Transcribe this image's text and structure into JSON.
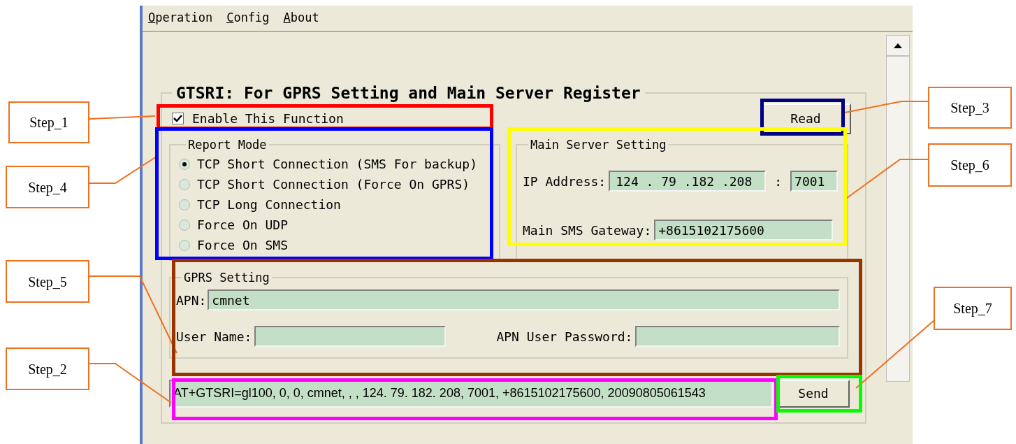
{
  "menu": [
    {
      "label": "Operation"
    },
    {
      "label": "Config"
    },
    {
      "label": "About"
    }
  ],
  "group_title": "GTSRI: For GPRS Setting and Main Server Register",
  "enable": {
    "label": "Enable This Function",
    "checked": true
  },
  "read_button": "Read",
  "report_mode": {
    "title": "Report Mode",
    "options": [
      {
        "label": "TCP Short Connection (SMS For backup)",
        "selected": true
      },
      {
        "label": "TCP Short Connection (Force On GPRS)",
        "selected": false
      },
      {
        "label": "TCP Long Connection",
        "selected": false
      },
      {
        "label": "Force On UDP",
        "selected": false
      },
      {
        "label": "Force On SMS",
        "selected": false
      }
    ]
  },
  "main_server": {
    "title": "Main Server Setting",
    "ip_label": "IP Address:",
    "ip_value": "124 . 79 .182 .208",
    "port_separator": ":",
    "port_value": "7001",
    "sms_label": "Main SMS Gateway:",
    "sms_value": "+8615102175600"
  },
  "gprs": {
    "title": "GPRS Setting",
    "apn_label": "APN:",
    "apn_value": "cmnet",
    "user_label": "User Name:",
    "password_label": "APN User Password:"
  },
  "command": "AT+GTSRI=gl100, 0, 0, cmnet, , , 124. 79. 182. 208, 7001, +8615102175600, 20090805061543",
  "send_button": "Send",
  "annotations": [
    {
      "label": "Step_1",
      "color": "#ff0000"
    },
    {
      "label": "Step_2",
      "color": "#ff00ff"
    },
    {
      "label": "Step_3",
      "color": "#000080"
    },
    {
      "label": "Step_4",
      "color": "#0000ff"
    },
    {
      "label": "Step_5",
      "color": "#993300"
    },
    {
      "label": "Step_6",
      "color": "#ffff00"
    },
    {
      "label": "Step_7",
      "color": "#00ff00"
    }
  ]
}
